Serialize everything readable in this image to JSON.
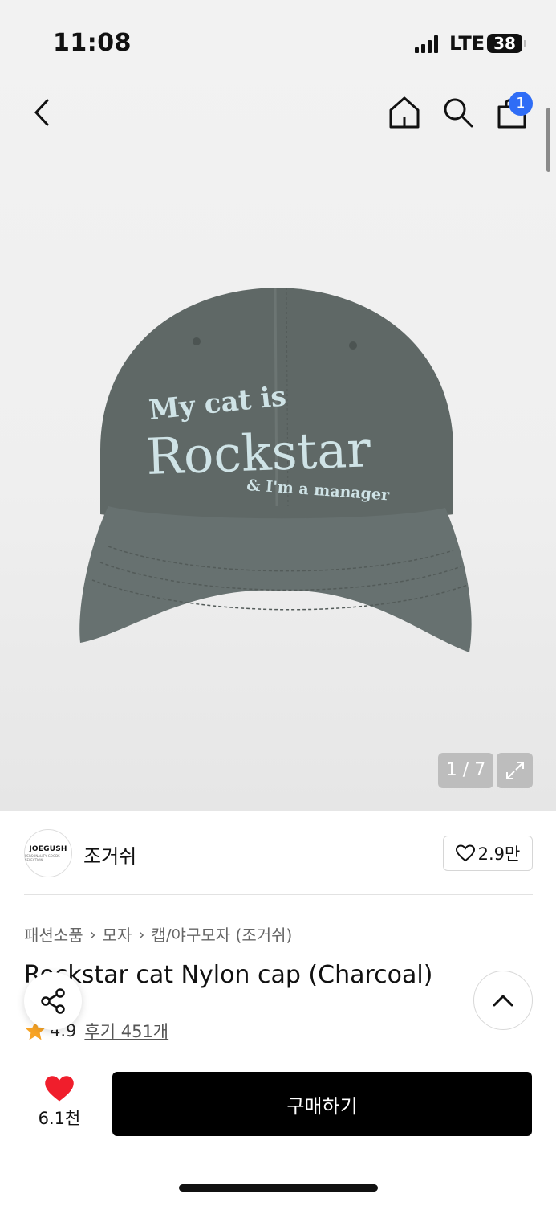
{
  "status_bar": {
    "time": "11:08",
    "network": "LTE",
    "battery": "38"
  },
  "top_nav": {
    "cart_count": "1"
  },
  "gallery": {
    "counter": "1 / 7"
  },
  "cap_embroidery": {
    "line1": "My cat is",
    "line2": "Rockstar",
    "line3": "& I'm a manager"
  },
  "brand": {
    "logo_text": "JOEGUSH",
    "logo_sub": "PERSONALITY GOODS SELECTION",
    "name": "조거쉬",
    "likes": "2.9만"
  },
  "breadcrumb": [
    "패션소품",
    "모자",
    "캡/야구모자 (조거쉬)"
  ],
  "product": {
    "title": "Rockstar cat Nylon cap (Charcoal)",
    "rating": "4.9",
    "reviews": "후기 451개"
  },
  "bottom": {
    "wish_count": "6.1천",
    "buy_label": "구매하기"
  },
  "colors": {
    "accent_blue": "#2f6df6",
    "heart_red": "#f01e2c",
    "star_orange": "#f7a325",
    "cap_charcoal": "#5f6866"
  }
}
